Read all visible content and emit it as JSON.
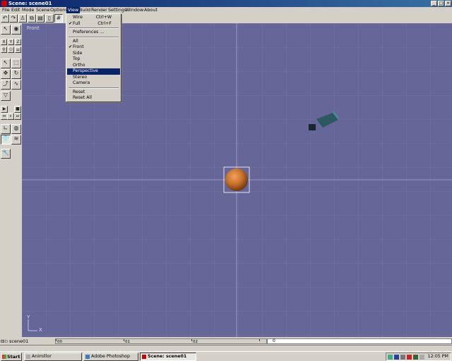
{
  "window": {
    "title": "Scene: scene01"
  },
  "menubar": {
    "items": [
      {
        "label": "File"
      },
      {
        "label": "Edit"
      },
      {
        "label": "Mode"
      },
      {
        "label": "Scene"
      },
      {
        "label": "Options"
      },
      {
        "label": "View"
      },
      {
        "label": "Build"
      },
      {
        "label": "Render"
      },
      {
        "label": "Settings"
      },
      {
        "label": "Window"
      },
      {
        "label": "About"
      }
    ]
  },
  "view_menu": {
    "items": [
      {
        "label": "Wire",
        "shortcut": "Ctrl+W",
        "checked": false
      },
      {
        "label": "Full",
        "shortcut": "Ctrl+F",
        "checked": true
      },
      {
        "label": "Preferences ..."
      },
      {
        "label": "All"
      },
      {
        "label": "Front",
        "checked": true
      },
      {
        "label": "Side"
      },
      {
        "label": "Top"
      },
      {
        "label": "Ortho"
      },
      {
        "label": "Perspective",
        "highlighted": true
      },
      {
        "label": "Stereo"
      },
      {
        "label": "Camera"
      },
      {
        "label": "Reset"
      },
      {
        "label": "Reset All"
      }
    ]
  },
  "viewport": {
    "label": "Front",
    "axis_y": "Y",
    "axis_x": "X",
    "background": "#666699"
  },
  "timeline": {
    "scene_name": "scene01",
    "ruler_labels": [
      "00",
      "01",
      "02"
    ],
    "frame_value": "0"
  },
  "taskbar": {
    "start_label": "Start",
    "tasks": [
      {
        "label": "Animillor"
      },
      {
        "label": "Adobe Photoshop"
      },
      {
        "label": "Scene: scene01"
      }
    ],
    "clock": "12:05 PM"
  },
  "colors": {
    "accent": "#0a246a",
    "viewport": "#666699",
    "sphere": "#c8702a"
  }
}
